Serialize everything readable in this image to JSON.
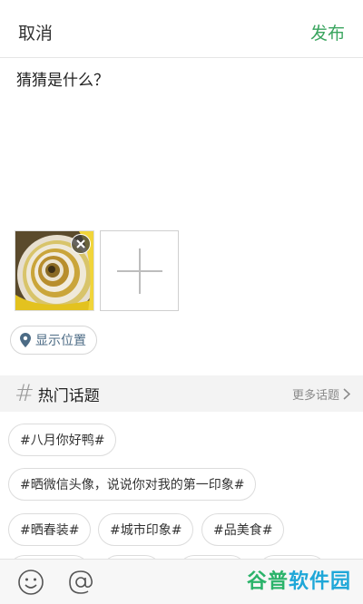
{
  "header": {
    "cancel_label": "取消",
    "publish_label": "发布"
  },
  "post": {
    "text": "猜猜是什么？"
  },
  "images": {
    "thumb_icon": "spiral-staircase-photo",
    "close_icon": "close-icon",
    "add_icon": "plus-icon"
  },
  "location": {
    "label": "显示位置",
    "icon": "location-pin-icon"
  },
  "topics": {
    "title": "热门话题",
    "hash_glyph": "#",
    "more_label": "更多话题",
    "tags": [
      "#八月你好鸭#",
      "#晒微信头像，说说你对我的第一印象#",
      "#晒春装#",
      "#城市印象#",
      "#品美食#"
    ]
  },
  "toolbar": {
    "emoji_icon": "emoji-icon",
    "mention_icon": "at-mention-icon"
  },
  "watermark": {
    "part1": "谷普",
    "part2": "软件园"
  },
  "colors": {
    "accent": "#3aa55f",
    "location_text": "#4c6b85",
    "section_bg": "#f3f3f3"
  }
}
